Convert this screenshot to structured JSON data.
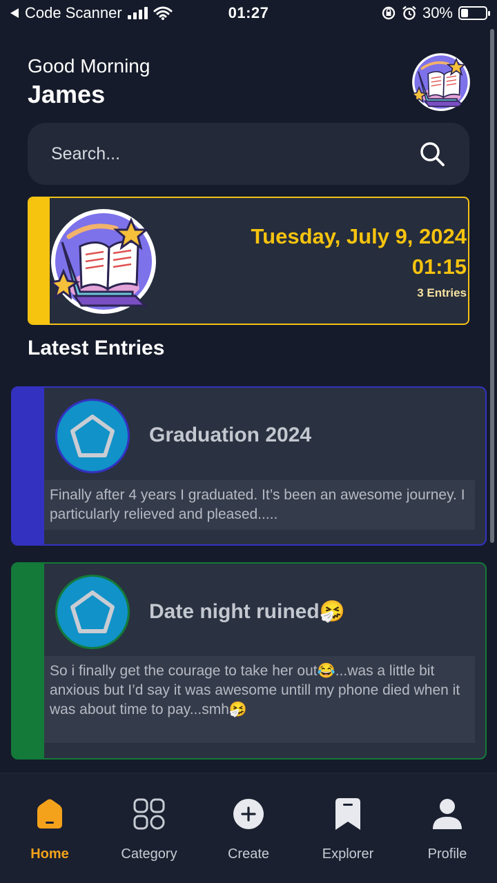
{
  "status_bar": {
    "back_app": "Code Scanner",
    "time": "01:27",
    "battery": "30%",
    "battery_level": 0.3
  },
  "header": {
    "greeting": "Good Morning",
    "user_name": "James",
    "avatar_icon": "book-laptop-avatar"
  },
  "search": {
    "placeholder": "Search..."
  },
  "date_card": {
    "date": "Tuesday, July 9, 2024",
    "time": "01:15",
    "entries": "3 Entries",
    "accent_color": "#f6c30f"
  },
  "latest": {
    "title": "Latest Entries",
    "entries": [
      {
        "title": "Graduation 2024",
        "body": "Finally after 4 years I graduated. It’s been an awesome journey. I particularly relieved and pleased.....",
        "accent_color": "#3332c0",
        "icon": "pentagon-icon"
      },
      {
        "title": "Date night ruined🤧",
        "body": "So i finally get the courage to take her out😂...was a little bit anxious but I’d say it was awesome untill my phone died when it was about time to pay...smh🤧",
        "accent_color": "#147a3a",
        "icon": "pentagon-icon"
      }
    ]
  },
  "nav": {
    "items": [
      {
        "label": "Home",
        "icon": "home-icon",
        "active": true
      },
      {
        "label": "Category",
        "icon": "category-grid-icon",
        "active": false
      },
      {
        "label": "Create",
        "icon": "plus-circle-icon",
        "active": false
      },
      {
        "label": "Explorer",
        "icon": "bookmark-icon",
        "active": false
      },
      {
        "label": "Profile",
        "icon": "person-icon",
        "active": false
      }
    ],
    "active_color": "#f4a21b"
  }
}
